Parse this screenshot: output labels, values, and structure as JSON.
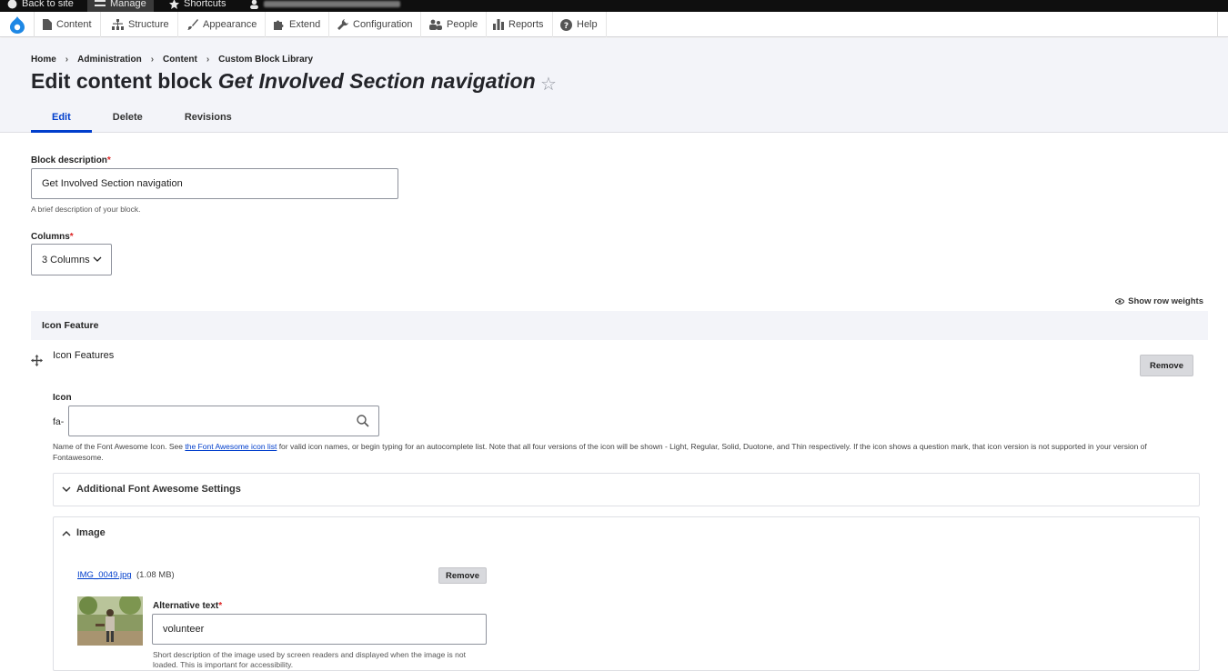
{
  "toolbar": {
    "back_to_site": "Back to site",
    "manage": "Manage",
    "shortcuts": "Shortcuts"
  },
  "tray": {
    "items": [
      {
        "label": "Content",
        "icon": "file-icon"
      },
      {
        "label": "Structure",
        "icon": "sitemap-icon"
      },
      {
        "label": "Appearance",
        "icon": "paintbrush-icon"
      },
      {
        "label": "Extend",
        "icon": "puzzle-icon"
      },
      {
        "label": "Configuration",
        "icon": "wrench-icon"
      },
      {
        "label": "People",
        "icon": "people-icon"
      },
      {
        "label": "Reports",
        "icon": "bar-chart-icon"
      },
      {
        "label": "Help",
        "icon": "question-icon"
      }
    ]
  },
  "header": {
    "breadcrumb": [
      "Home",
      "Administration",
      "Content",
      "Custom Block Library"
    ],
    "title_prefix": "Edit content block ",
    "title_emph": "Get Involved Section navigation",
    "tabs": [
      "Edit",
      "Delete",
      "Revisions"
    ]
  },
  "form": {
    "block_description": {
      "label": "Block description",
      "required": "*",
      "value": "Get Involved Section navigation",
      "description": "A brief description of your block."
    },
    "columns": {
      "label": "Columns",
      "required": "*",
      "selected": "3 Columns"
    },
    "show_row_weights": "Show row weights",
    "icon_feature": {
      "heading": "Icon Feature",
      "item_label": "Icon Features",
      "remove_label": "Remove",
      "icon_label": "Icon",
      "prefix": "fa-",
      "icon_value": "",
      "icon_desc_before": "Name of the Font Awesome Icon. See ",
      "icon_desc_link": "the Font Awesome icon list",
      "icon_desc_after": " for valid icon names, or begin typing for an autocomplete list. Note that all four versions of the icon will be shown - Light, Regular, Solid, Duotone, and Thin respectively. If the icon shows a question mark, that icon version is not supported in your version of Fontawesome.",
      "additional_settings": "Additional Font Awesome Settings",
      "image_summary": "Image",
      "file_name": "IMG_0049.jpg",
      "file_size": "(1.08 MB)",
      "file_remove": "Remove",
      "alt_label": "Alternative text",
      "alt_required": "*",
      "alt_value": "volunteer",
      "alt_desc": "Short description of the image used by screen readers and displayed when the image is not loaded. This is important for accessibility."
    }
  },
  "colors": {
    "accent": "#003ecc",
    "required": "#dc2323",
    "header_bg": "#f3f4f9"
  }
}
